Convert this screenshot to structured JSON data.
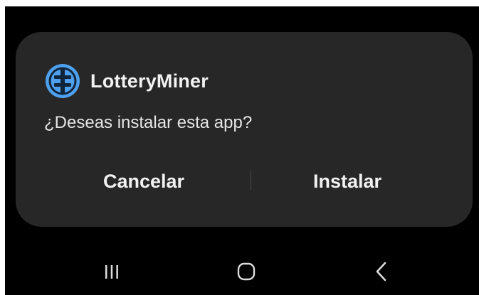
{
  "dialog": {
    "app_name": "LotteryMiner",
    "app_icon": "lottery-miner-app-icon",
    "question": "¿Deseas instalar esta app?",
    "cancel_label": "Cancelar",
    "install_label": "Instalar"
  },
  "navbar": {
    "recents_icon": "recents-icon",
    "home_icon": "home-icon",
    "back_icon": "back-icon"
  },
  "colors": {
    "background": "#000000",
    "dialog": "#272727",
    "icon_accent": "#4ea0ee",
    "text": "#f2f2f2"
  }
}
